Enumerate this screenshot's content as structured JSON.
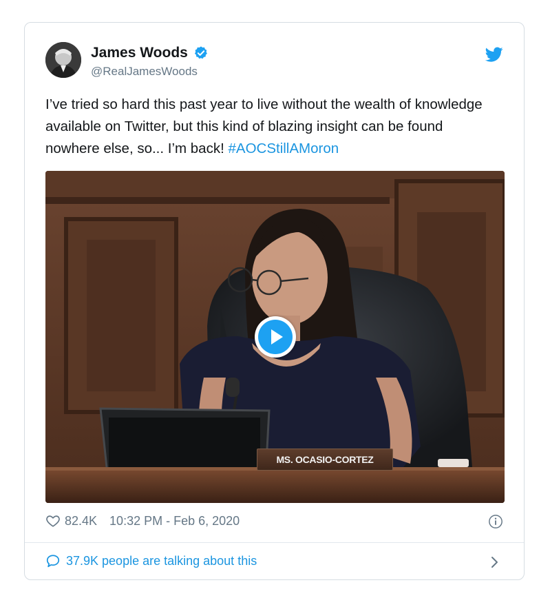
{
  "colors": {
    "text": "#14171a",
    "secondary": "#657786",
    "link": "#1b95e0",
    "brand_blue": "#1da1f2",
    "border": "#d5dce2"
  },
  "tweet": {
    "author": {
      "name": "James Woods",
      "handle": "@RealJamesWoods",
      "verified": true,
      "avatar_icon": "profile-photo"
    },
    "brand_icon": "twitter-bird-icon",
    "text_body": "I’ve tried so hard this past year to live without the wealth of knowledge available on Twitter, but this kind of blazing insight can be found nowhere else, so... I’m back!",
    "hashtag": "#AOCStillAMoron",
    "media": {
      "type": "video",
      "play_icon": "play-icon",
      "nameplate": "MS. OCASIO-CORTEZ"
    },
    "likes": "82.4K",
    "timestamp": "10:32 PM - Feb 6, 2020",
    "info_icon": "info-icon",
    "talking": "37.9K people are talking about this",
    "chevron_icon": "chevron-right-icon"
  }
}
